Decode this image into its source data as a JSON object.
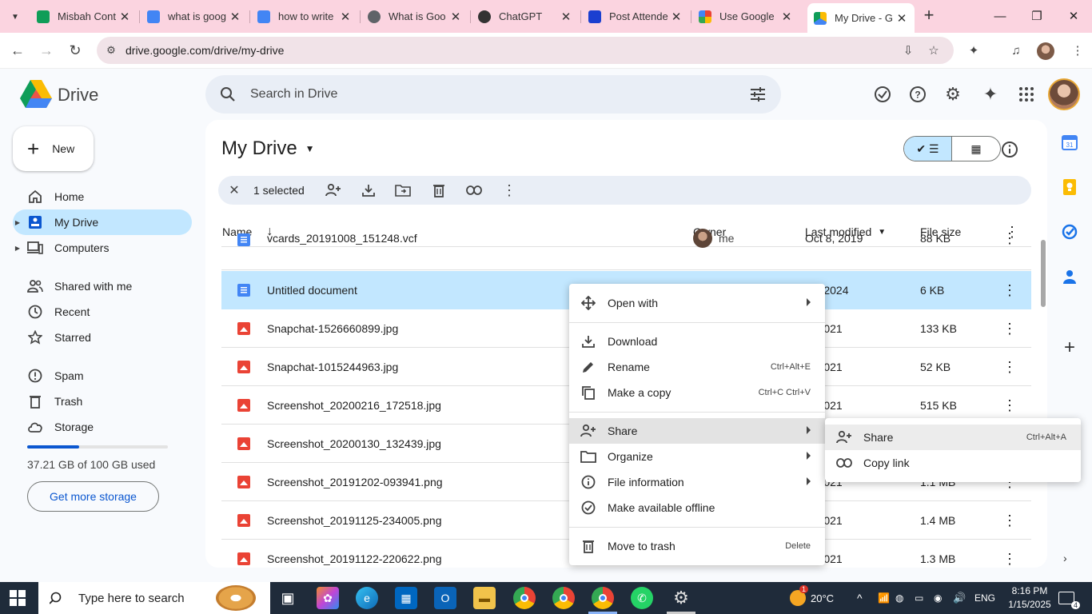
{
  "browser": {
    "tabs": [
      {
        "title": "Misbah Cont",
        "favicon": "sheets-icon",
        "color": "#0f9d58"
      },
      {
        "title": "what is goog",
        "favicon": "docs-icon",
        "color": "#4285f4"
      },
      {
        "title": "how to write",
        "favicon": "docs-icon",
        "color": "#4285f4"
      },
      {
        "title": "What is Goo",
        "favicon": "globe-icon",
        "color": "#5f6368"
      },
      {
        "title": "ChatGPT",
        "favicon": "chatgpt-icon",
        "color": "#333333"
      },
      {
        "title": "Post Attende",
        "favicon": "zoom-icon",
        "color": "#1a3fd0"
      },
      {
        "title": "Use Google",
        "favicon": "google-icon",
        "color": "#ffffff"
      },
      {
        "title": "My Drive - G",
        "favicon": "drive-icon",
        "color": "#ffffff",
        "active": true
      }
    ],
    "url": "drive.google.com/drive/my-drive"
  },
  "drive": {
    "app_name": "Drive",
    "search_placeholder": "Search in Drive",
    "new_label": "New",
    "nav": [
      {
        "label": "Home",
        "icon": "home-icon"
      },
      {
        "label": "My Drive",
        "icon": "my-drive-icon",
        "active": true
      },
      {
        "label": "Computers",
        "icon": "computer-icon"
      },
      {
        "label": "Shared with me",
        "icon": "shared-icon"
      },
      {
        "label": "Recent",
        "icon": "clock-icon"
      },
      {
        "label": "Starred",
        "icon": "star-icon"
      },
      {
        "label": "Spam",
        "icon": "spam-icon"
      },
      {
        "label": "Trash",
        "icon": "trash-icon"
      },
      {
        "label": "Storage",
        "icon": "cloud-icon"
      }
    ],
    "storage": {
      "text": "37.21 GB of 100 GB used",
      "fraction": 0.3721,
      "button": "Get more storage"
    },
    "main": {
      "title": "My Drive",
      "selected_count": "1 selected",
      "columns": {
        "name": "Name",
        "owner": "Owner",
        "modified": "Last modified",
        "size": "File size"
      },
      "files": [
        {
          "name": "vcards_20191008_151248.vcf",
          "type": "doc",
          "owner": "me",
          "modified": "Oct 8, 2019",
          "size": "88 KB"
        },
        {
          "name": "Untitled document",
          "type": "doc",
          "owner": "",
          "modified": "18, 2024",
          "size": "6 KB",
          "selected": true
        },
        {
          "name": "Snapchat-1526660899.jpg",
          "type": "img",
          "owner": "",
          "modified": "5, 2021",
          "size": "133 KB"
        },
        {
          "name": "Snapchat-1015244963.jpg",
          "type": "img",
          "owner": "",
          "modified": "5, 2021",
          "size": "52 KB"
        },
        {
          "name": "Screenshot_20200216_172518.jpg",
          "type": "img",
          "owner": "",
          "modified": "5, 2021",
          "size": "515 KB"
        },
        {
          "name": "Screenshot_20200130_132439.jpg",
          "type": "img",
          "owner": "",
          "modified": "",
          "size": ""
        },
        {
          "name": "Screenshot_20191202-093941.png",
          "type": "img",
          "owner": "",
          "modified": "5, 2021",
          "size": "1.1 MB"
        },
        {
          "name": "Screenshot_20191125-234005.png",
          "type": "img",
          "owner": "",
          "modified": "5, 2021",
          "size": "1.4 MB"
        },
        {
          "name": "Screenshot_20191122-220622.png",
          "type": "img",
          "owner": "",
          "modified": "5, 2021",
          "size": "1.3 MB"
        }
      ]
    },
    "context_menu": {
      "open_with": "Open with",
      "download": "Download",
      "rename": "Rename",
      "rename_sc": "Ctrl+Alt+E",
      "copy": "Make a copy",
      "copy_sc": "Ctrl+C Ctrl+V",
      "share": "Share",
      "organize": "Organize",
      "file_info": "File information",
      "offline": "Make available offline",
      "trash": "Move to trash",
      "trash_sc": "Delete"
    },
    "share_submenu": {
      "share": "Share",
      "share_sc": "Ctrl+Alt+A",
      "copy_link": "Copy link"
    }
  },
  "taskbar": {
    "search_placeholder": "Type here to search",
    "weather": "20°C",
    "weather_badge": "1",
    "lang": "ENG",
    "time": "8:16 PM",
    "date": "1/15/2025",
    "notifications": "4"
  }
}
